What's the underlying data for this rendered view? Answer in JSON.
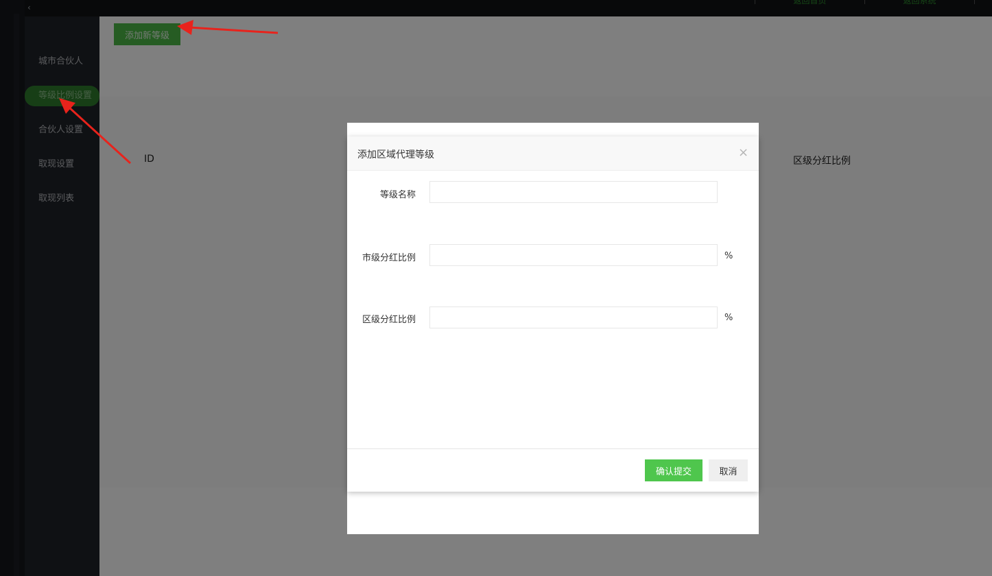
{
  "topbar": {
    "collapse_icon": "chevron-left-icon",
    "nav_links": [
      "返回首页",
      "返回系统"
    ]
  },
  "sidebar": {
    "items": [
      {
        "label": "城市合伙人",
        "active": false
      },
      {
        "label": "等级比例设置",
        "active": true
      },
      {
        "label": "合伙人设置",
        "active": false
      },
      {
        "label": "取现设置",
        "active": false
      },
      {
        "label": "取现列表",
        "active": false
      }
    ]
  },
  "main": {
    "add_level_label": "添加新等级",
    "table_headers": {
      "id": "ID",
      "district_ratio": "区级分红比例"
    }
  },
  "modal": {
    "title": "添加区域代理等级",
    "close_icon": "close-icon",
    "fields": [
      {
        "label": "等级名称",
        "value": "",
        "placeholder": "",
        "unit": ""
      },
      {
        "label": "市级分红比例",
        "value": "",
        "placeholder": "",
        "unit": "%"
      },
      {
        "label": "区级分红比例",
        "value": "",
        "placeholder": "",
        "unit": "%"
      }
    ],
    "submit_label": "确认提交",
    "cancel_label": "取消"
  },
  "colors": {
    "accent_green": "#4fc64d",
    "sidebar_bg": "#1f2229",
    "sidebar_active": "#2f7c2d",
    "annotation_red": "#e8231c"
  }
}
